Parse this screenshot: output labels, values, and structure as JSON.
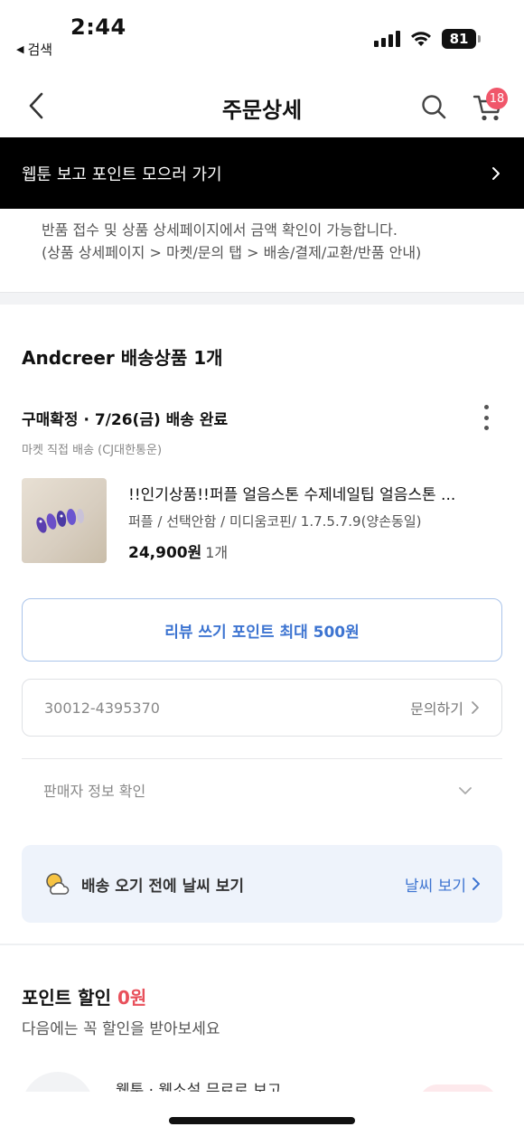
{
  "status_bar": {
    "time": "2:44",
    "back_app_label": "검색",
    "battery": "81"
  },
  "header": {
    "title": "주문상세",
    "cart_badge": "18"
  },
  "banner": {
    "text": "웹툰 보고 포인트 모으러 가기"
  },
  "notice": {
    "line1": "반품 접수 및 상품 상세페이지에서 금액 확인이 가능합니다.",
    "line2": "(상품 상세페이지 > 마켓/문의 탭 > 배송/결제/교환/반품 안내)"
  },
  "order": {
    "seller_title": "Andcreer 배송상품 1개",
    "status": "구매확정 · 7/26(금) 배송 완료",
    "delivery_info": "마켓 직접 배송 (CJ대한통운)",
    "product_name": "!!인기상품!!퍼플 얼음스톤 수제네일팁 얼음스톤 ...",
    "product_option": "퍼플 / 선택안함 / 미디움코핀/ 1.7.5.7.9(양손동일)",
    "price": "24,900원",
    "quantity": "1개",
    "review_button": "리뷰 쓰기 포인트 최대 500원",
    "order_number": "30012-4395370",
    "inquiry_label": "문의하기",
    "seller_info_label": "판매자 정보 확인"
  },
  "weather": {
    "text": "배송 오기 전에 날씨 보기",
    "link": "날씨 보기"
  },
  "points": {
    "title": "포인트 할인",
    "amount": "0원",
    "subtitle": "다음에는 꼭 할인을 받아보세요",
    "partial_text": "웹툰 · 웹소설 무료로 보고"
  },
  "colors": {
    "accent_blue": "#3d74d1",
    "badge_red": "#f0566a",
    "points_red": "#e8505b"
  }
}
